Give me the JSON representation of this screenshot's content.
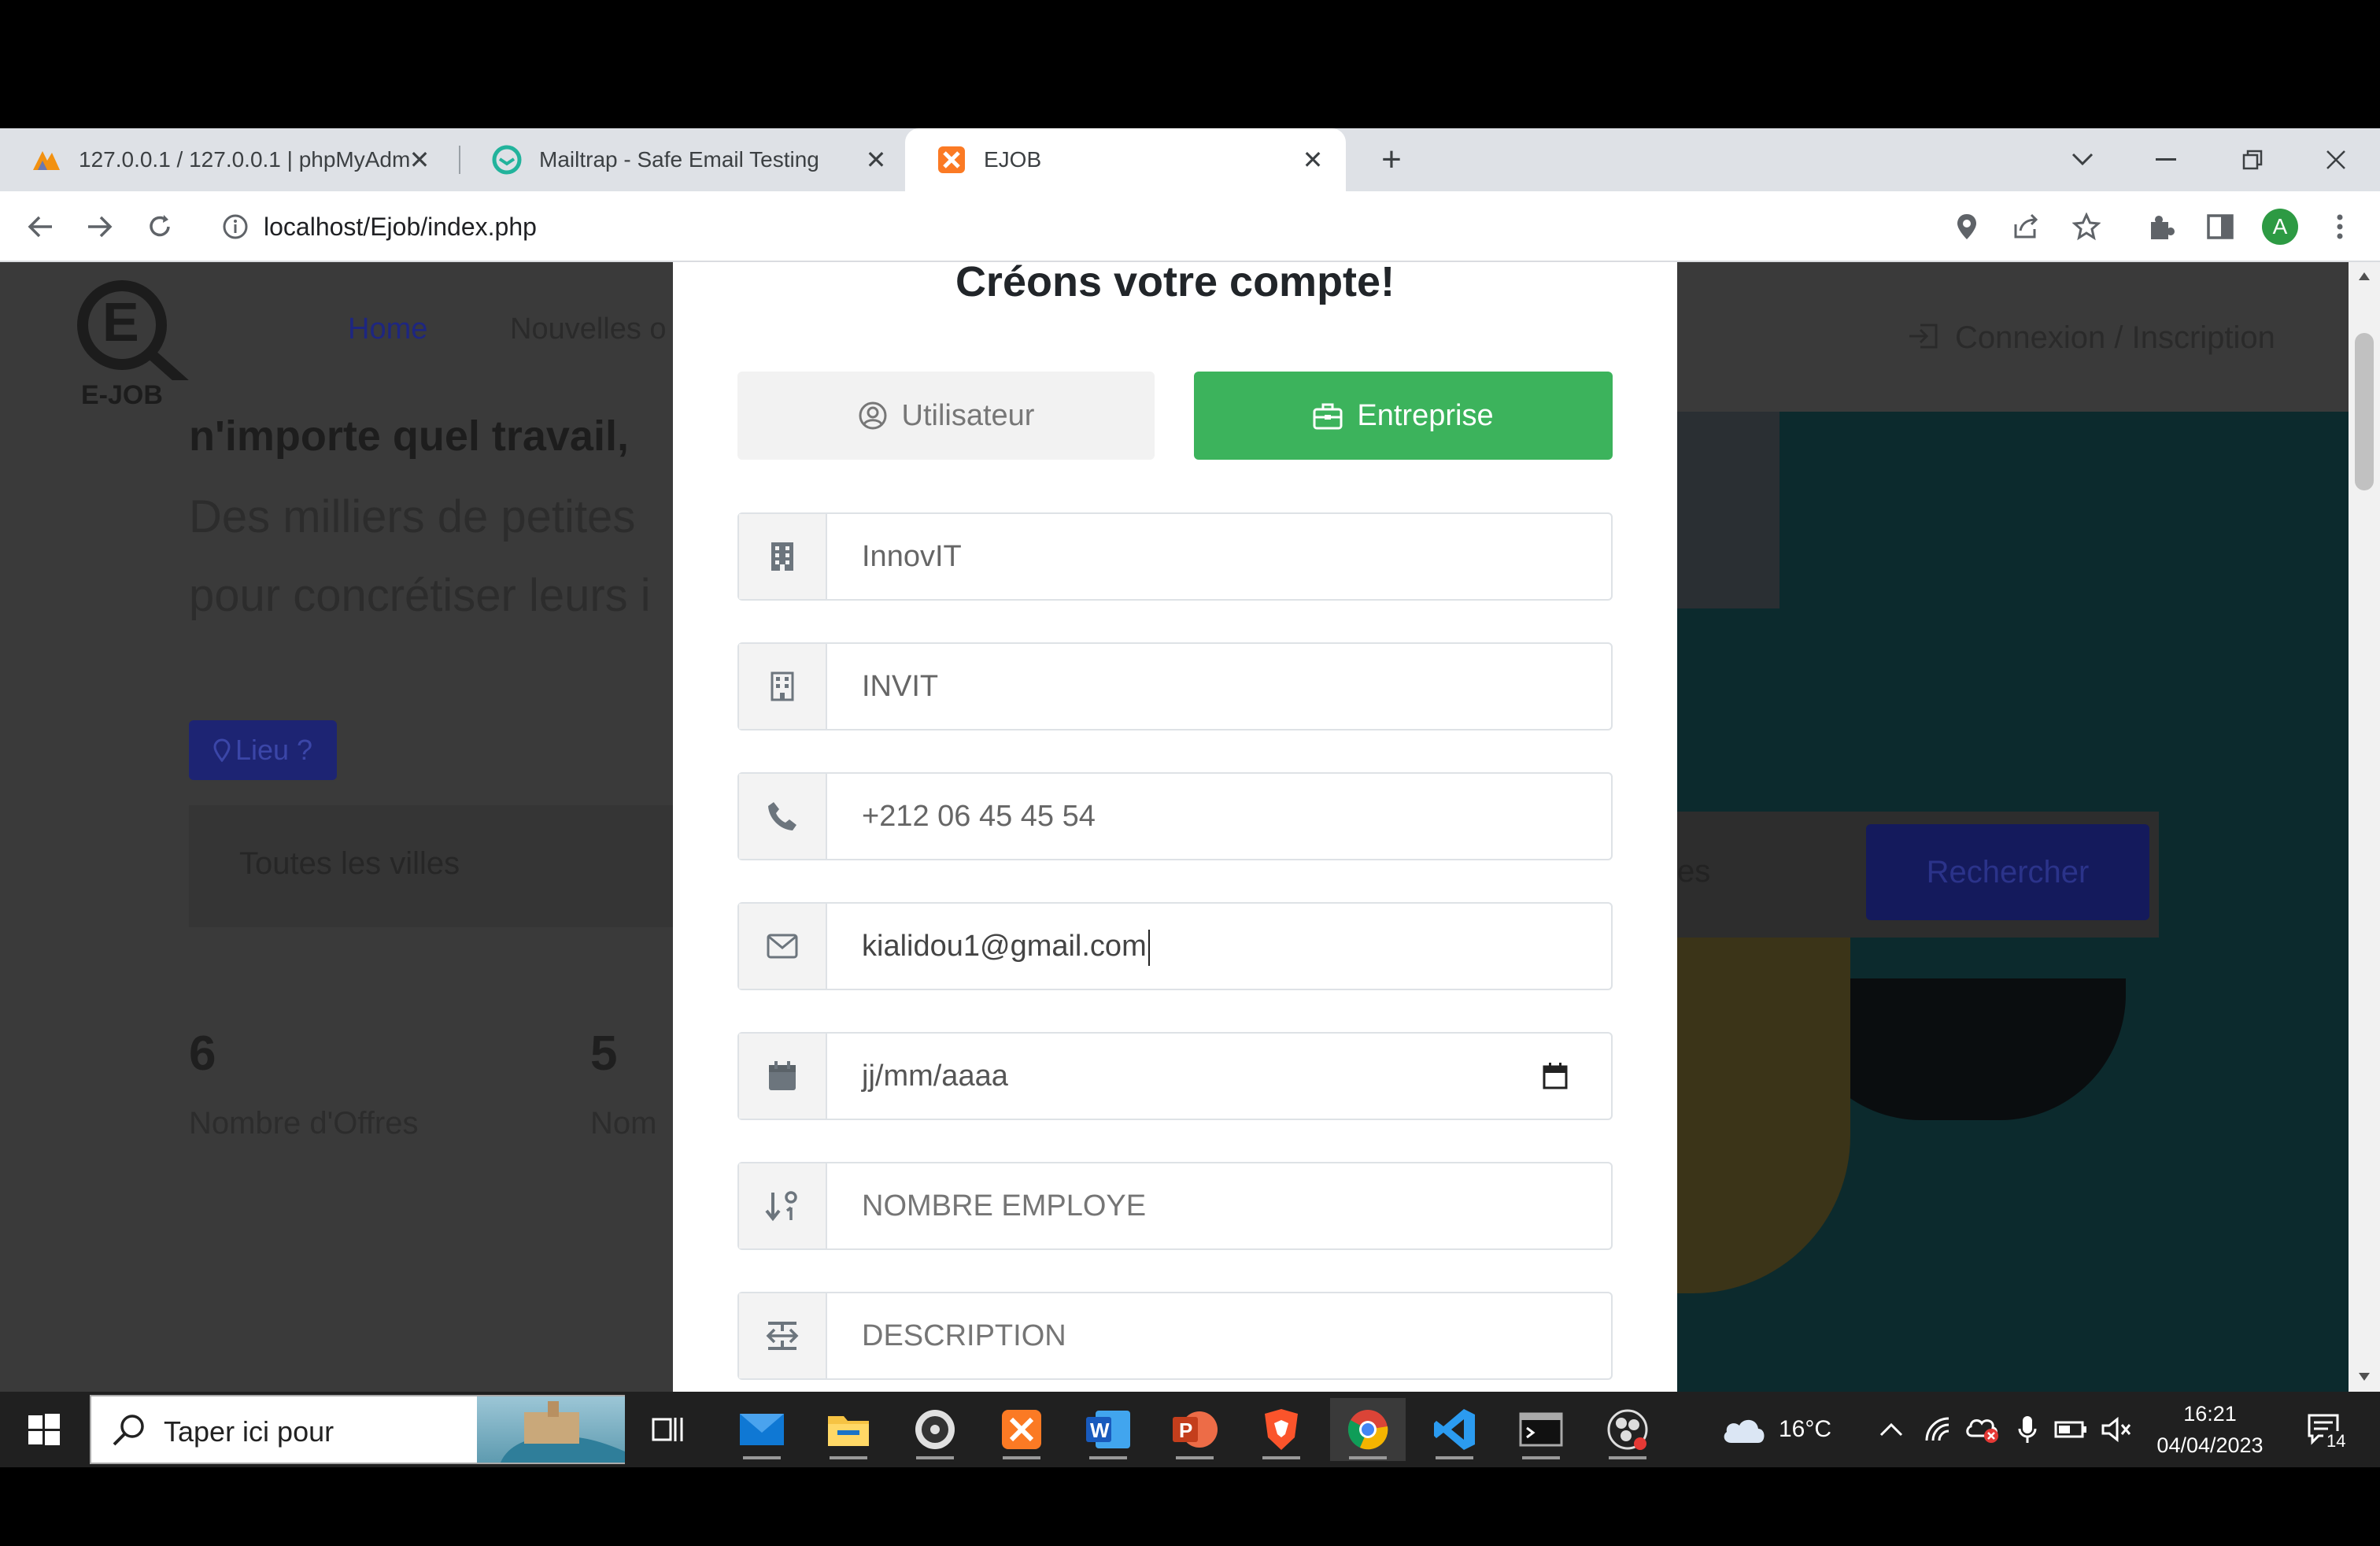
{
  "browser": {
    "tabs": [
      {
        "title": "127.0.0.1 / 127.0.0.1 | phpMyAdmin",
        "favicon": "phpmyadmin-icon"
      },
      {
        "title": "Mailtrap - Safe Email Testing",
        "favicon": "mailtrap-icon"
      },
      {
        "title": "EJOB",
        "favicon": "xampp-icon",
        "active": true
      }
    ],
    "url": "localhost/Ejob/index.php",
    "profile_initial": "A"
  },
  "background": {
    "nav": {
      "home": "Home",
      "nouvelles": "Nouvelles o",
      "login": "Connexion / Inscription"
    },
    "logo": "E-JOB",
    "headline": "n'importe quel travail,",
    "sub1": "Des milliers de petites",
    "sub2": "pour concrétiser leurs i",
    "lieu_button": "Lieu ?",
    "city_select": "Toutes les villes",
    "cat_select_fragment": "es",
    "search_button": "Rechercher",
    "stats": [
      {
        "value": "6",
        "label": "Nombre d'Offres"
      },
      {
        "value": "5",
        "label": "Nom"
      }
    ]
  },
  "modal": {
    "title": "Créons votre compte!",
    "toggle_user": "Utilisateur",
    "toggle_company": "Entreprise",
    "fields": {
      "company_name": "InnovIT",
      "company_code": "INVIT",
      "phone": "+212 06 45 45 54",
      "email": "kialidou1@gmail.com",
      "date_placeholder": "jj/mm/aaaa",
      "employees_placeholder": "NOMBRE EMPLOYE",
      "description_placeholder": "DESCRIPTION"
    }
  },
  "taskbar": {
    "search_placeholder": "Taper ici pour",
    "weather": "16°C",
    "time": "16:21",
    "date": "04/04/2023",
    "notifications": "14"
  },
  "colors": {
    "success": "#3cb35c",
    "primary_dark": "#1e2473",
    "lieu_blue": "#2b36a3"
  }
}
